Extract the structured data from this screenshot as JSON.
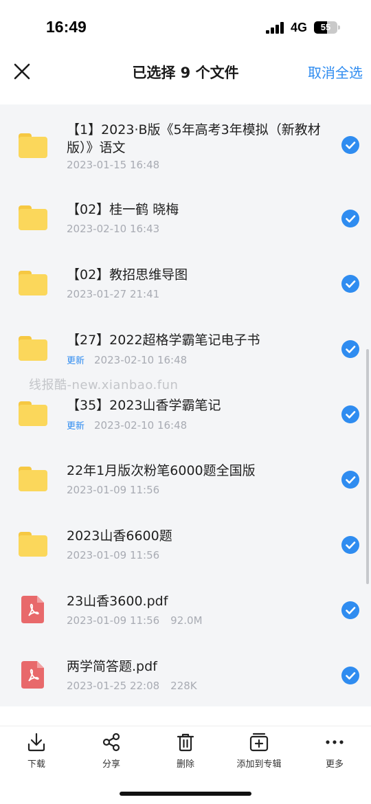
{
  "status_bar": {
    "time": "16:49",
    "network": "4G",
    "battery": "55",
    "battery_level": 0.55
  },
  "header": {
    "title": "已选择 9 个文件",
    "cancel_select_all": "取消全选"
  },
  "watermark": "线报酷-new.xianbao.fun",
  "files": [
    {
      "type": "folder",
      "name": "【1】2023·B版《5年高考3年模拟（新教材版）》语文",
      "date": "2023-01-15 16:48",
      "selected": true
    },
    {
      "type": "folder",
      "name": "【02】桂一鹤 晓梅",
      "date": "2023-02-10 16:43",
      "selected": true
    },
    {
      "type": "folder",
      "name": "【02】教招思维导图",
      "date": "2023-01-27 21:41",
      "selected": true
    },
    {
      "type": "folder",
      "name": "【27】2022超格学霸笔记电子书",
      "badge": "更新",
      "date": "2023-02-10 16:48",
      "selected": true
    },
    {
      "type": "folder",
      "name": "【35】2023山香学霸笔记",
      "badge": "更新",
      "date": "2023-02-10 16:48",
      "selected": true
    },
    {
      "type": "folder",
      "name": "22年1月版次粉笔6000题全国版",
      "date": "2023-01-09 11:56",
      "selected": true
    },
    {
      "type": "folder",
      "name": "2023山香6600题",
      "date": "2023-01-09 11:56",
      "selected": true
    },
    {
      "type": "pdf",
      "name": "23山香3600.pdf",
      "date": "2023-01-09 11:56",
      "size": "92.0M",
      "selected": true
    },
    {
      "type": "pdf",
      "name": "两学简答题.pdf",
      "date": "2023-01-25 22:08",
      "size": "228K",
      "selected": true
    }
  ],
  "toolbar": {
    "download": "下载",
    "share": "分享",
    "delete": "删除",
    "add_to_album": "添加到专辑",
    "more": "更多"
  },
  "colors": {
    "accent": "#2f8cf0",
    "folder": "#fbd75b",
    "pdf": "#e8696b",
    "list_bg": "#f4f5f7"
  }
}
